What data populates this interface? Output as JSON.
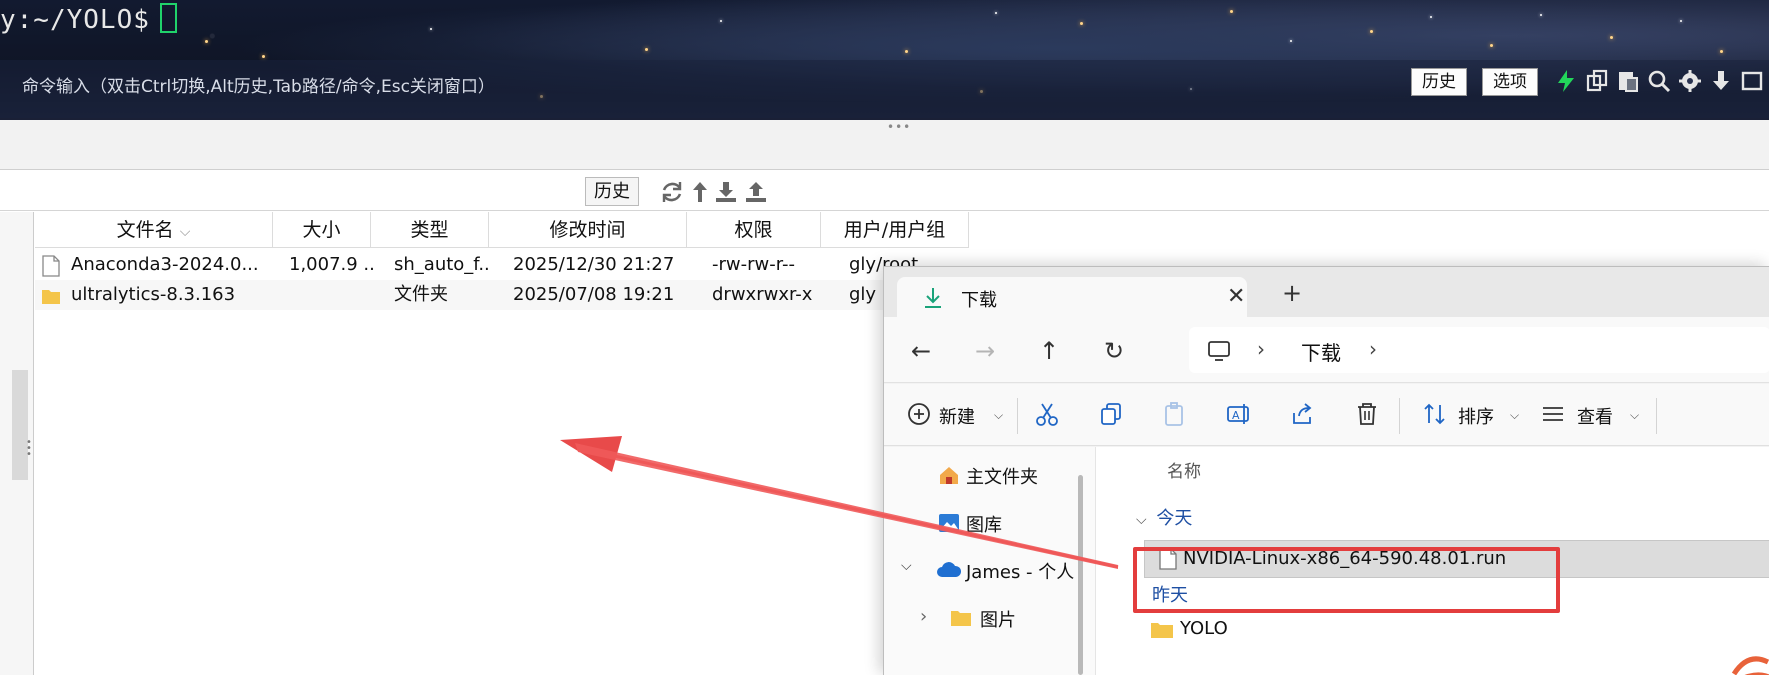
{
  "terminal": {
    "prompt": "y:~/YOLO$",
    "command_hint": "命令输入（双击Ctrl切换,Alt历史,Tab路径/命令,Esc关闭窗口）",
    "history_button": "历史",
    "options_button": "选项"
  },
  "sftp_toolbar": {
    "history_button": "历史"
  },
  "file_table": {
    "columns": [
      "文件名",
      "大小",
      "类型",
      "修改时间",
      "权限",
      "用户/用户组"
    ],
    "rows": [
      {
        "name": "Anaconda3-2024.0...",
        "size": "1,007.9 ...",
        "type": "sh_auto_f...",
        "modified": "2025/12/30 21:27",
        "perm": "-rw-rw-r--",
        "owner": "gly/root",
        "kind": "file"
      },
      {
        "name": "ultralytics-8.3.163",
        "size": "",
        "type": "文件夹",
        "modified": "2025/07/08 19:21",
        "perm": "drwxrwxr-x",
        "owner": "gly",
        "kind": "folder"
      }
    ]
  },
  "explorer": {
    "tab_title": "下载",
    "breadcrumb": "下载",
    "commands": {
      "new": "新建",
      "sort": "排序",
      "view": "查看"
    },
    "nav_pane": {
      "home": "主文件夹",
      "gallery": "图库",
      "onedrive": "James - 个人",
      "pictures": "图片"
    },
    "column_name": "名称",
    "groups": {
      "today": "今天",
      "yesterday": "昨天"
    },
    "files": {
      "highlighted": "NVIDIA-Linux-x86_64-590.48.01.run",
      "folder": "YOLO"
    }
  },
  "colors": {
    "annotation_red": "#e33d3d",
    "cursor_green": "#20d36b",
    "folder_yellow": "#f4c54a"
  }
}
